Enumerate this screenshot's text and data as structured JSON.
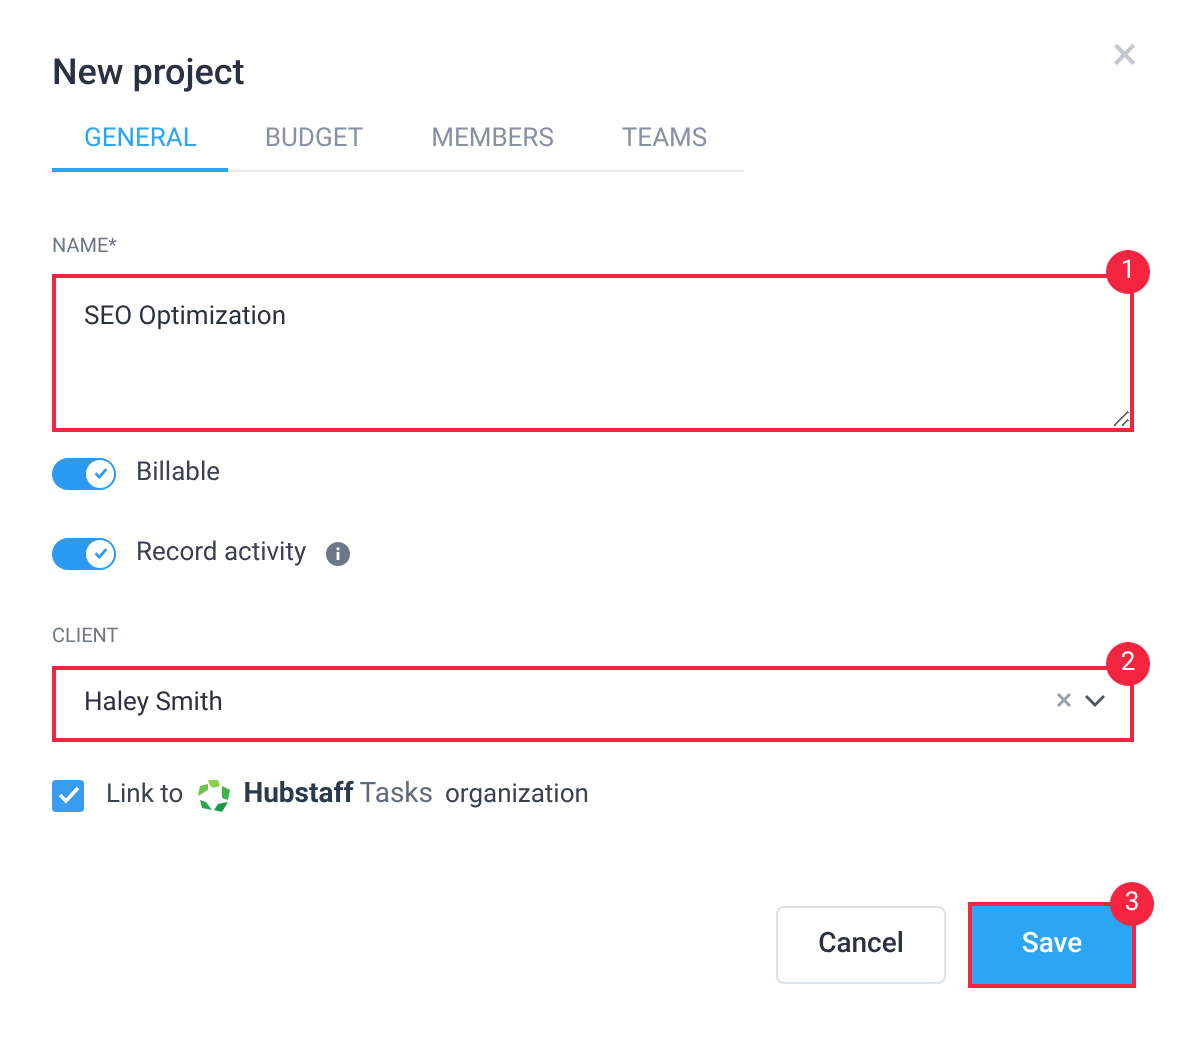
{
  "dialog": {
    "title": "New project",
    "close": "×"
  },
  "tabs": [
    {
      "label": "GENERAL",
      "selected": true
    },
    {
      "label": "BUDGET",
      "selected": false
    },
    {
      "label": "MEMBERS",
      "selected": false
    },
    {
      "label": "TEAMS",
      "selected": false
    }
  ],
  "name_field": {
    "label": "NAME*",
    "value": "SEO Optimization",
    "highlighted": true,
    "callout": "1"
  },
  "toggles": [
    {
      "label": "Billable",
      "on": true,
      "info": false
    },
    {
      "label": "Record activity",
      "on": true,
      "info": true
    }
  ],
  "client_field": {
    "label": "CLIENT",
    "value": "Haley Smith",
    "highlighted": true,
    "callout": "2"
  },
  "link_option": {
    "checked": true,
    "prefix": "Link to",
    "brand": "Hubstaff",
    "product": "Tasks",
    "suffix": "organization"
  },
  "buttons": [
    {
      "label": "Cancel",
      "kind": "secondary",
      "highlighted": false
    },
    {
      "label": "Save",
      "kind": "primary",
      "highlighted": true,
      "callout": "3"
    }
  ]
}
